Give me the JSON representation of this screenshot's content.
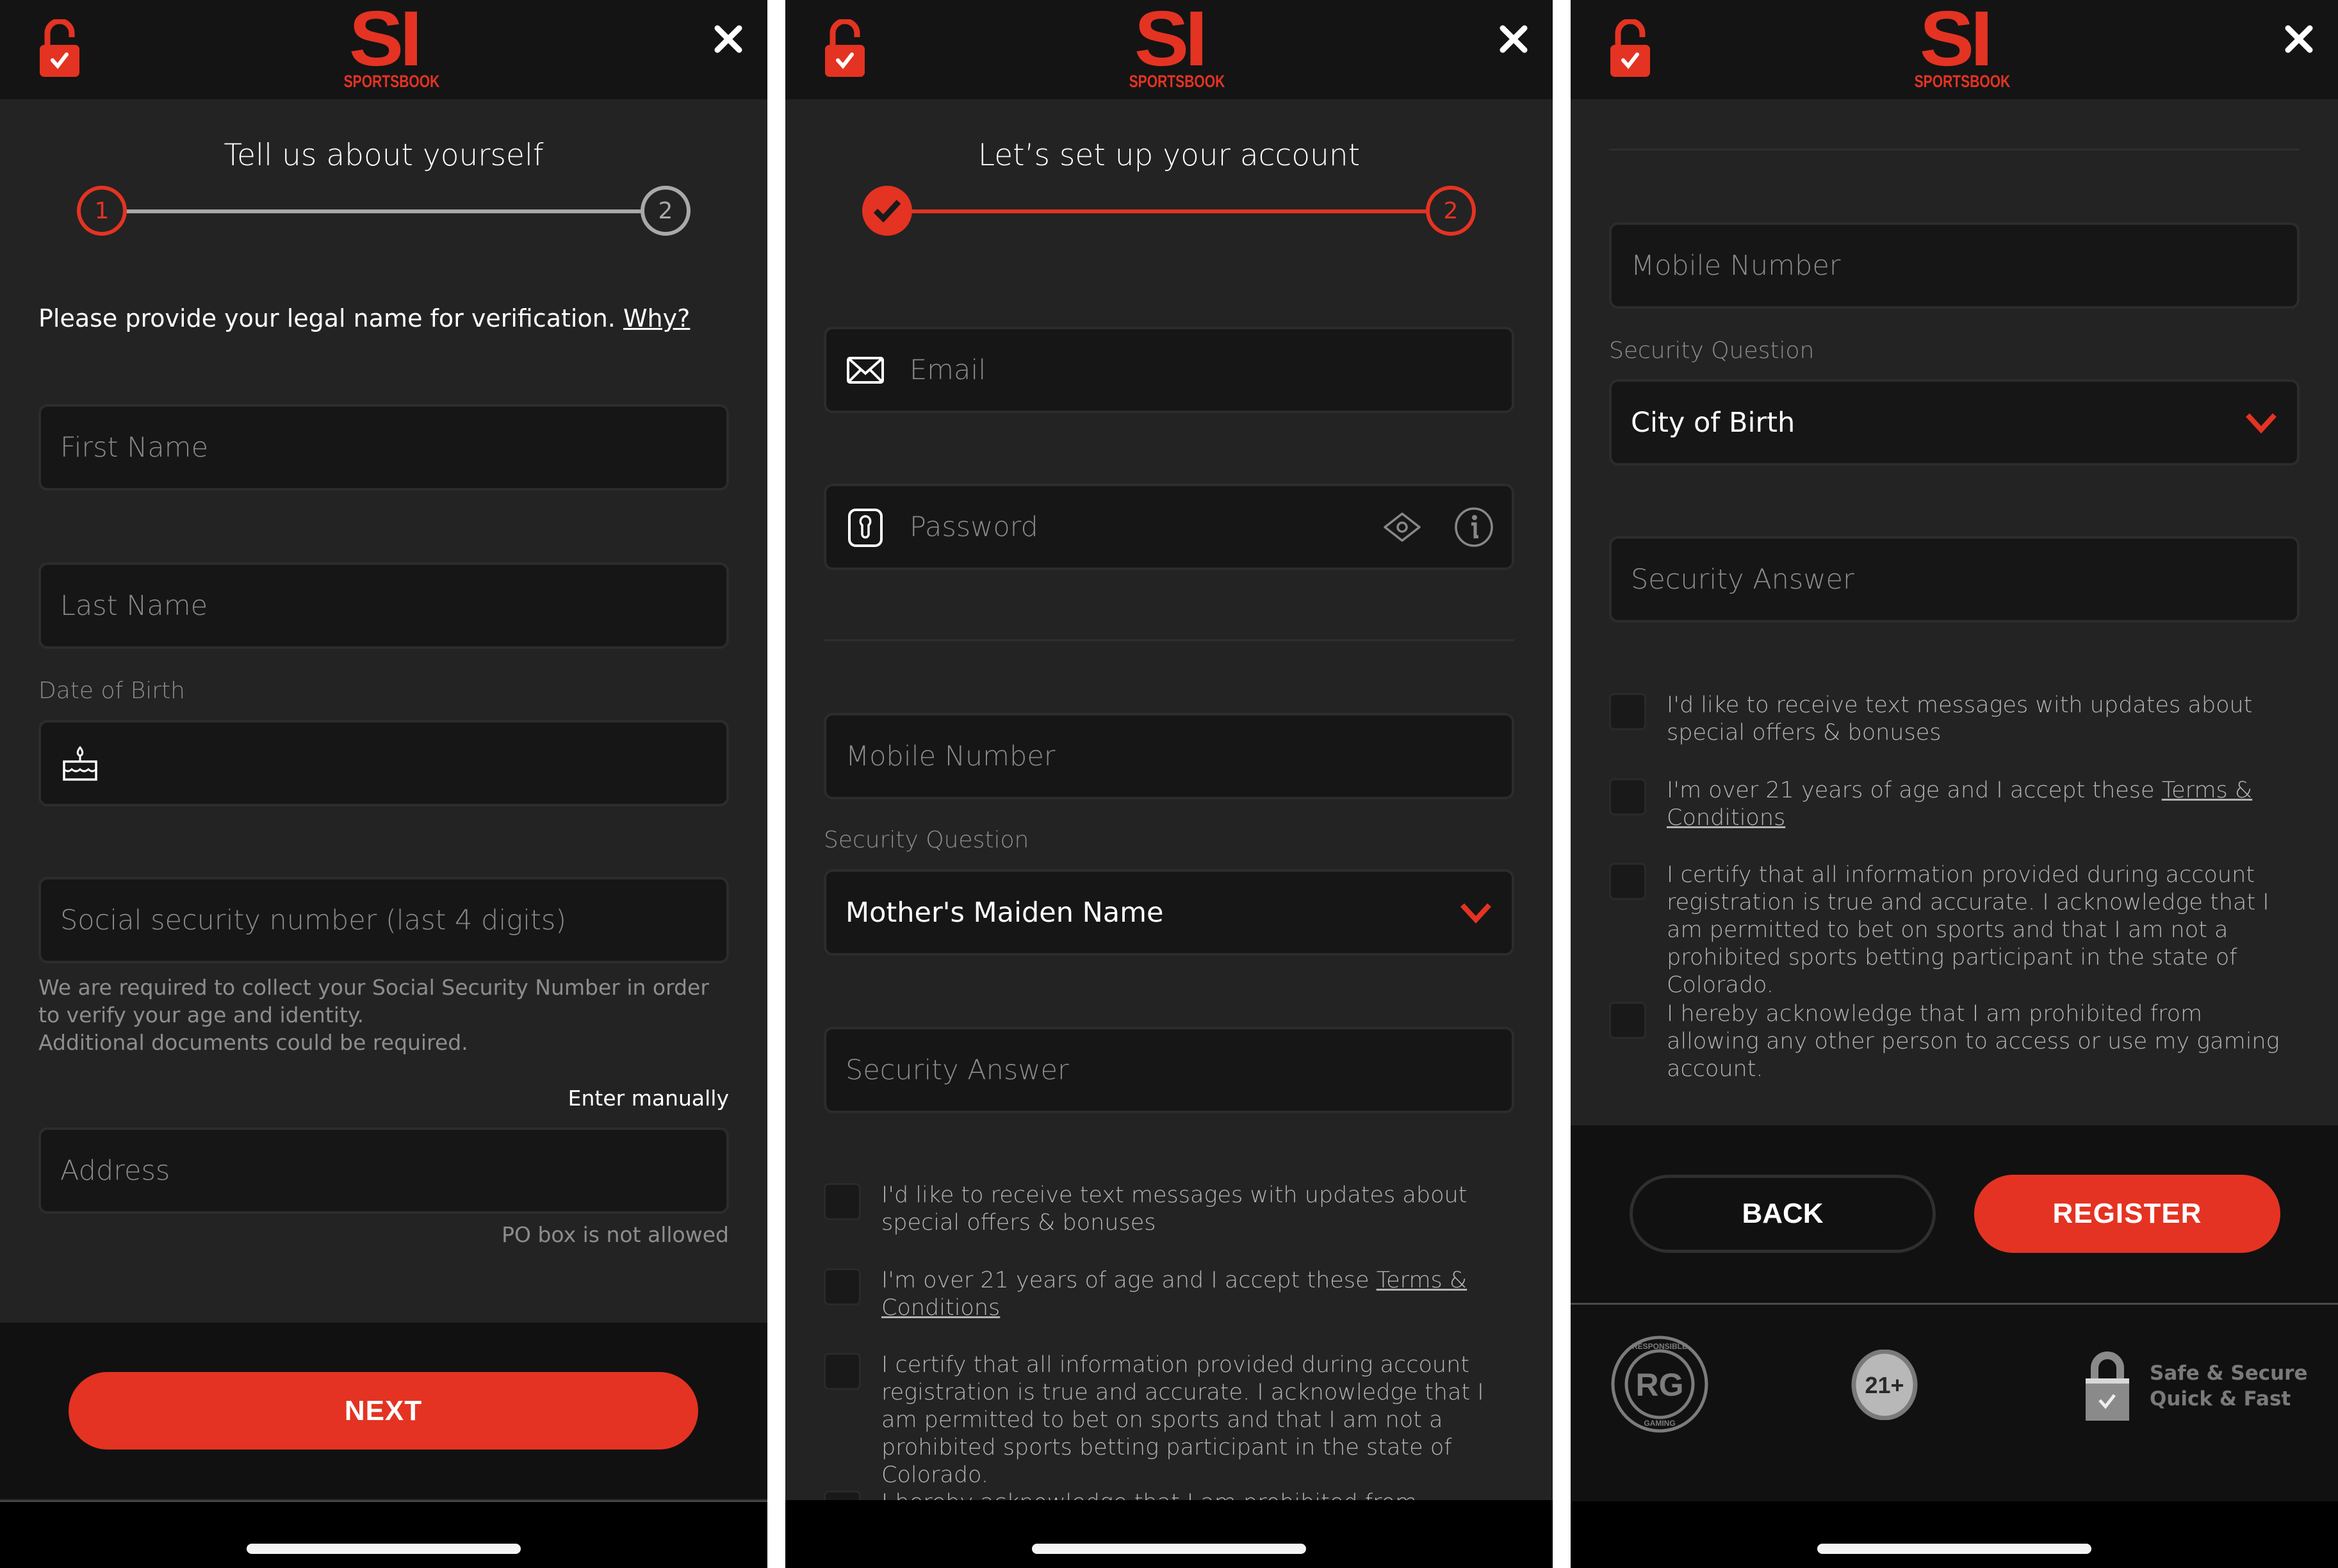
{
  "brand": {
    "logo_main": "SI",
    "logo_sub": "SPORTSBOOK",
    "accent_color": "#e43322"
  },
  "screen1": {
    "title": "Tell us about yourself",
    "stepper": {
      "step1": "1",
      "step2": "2",
      "active_step": 1
    },
    "instruction": "Please provide your legal name for verification.",
    "why_link": "Why?",
    "first_name_placeholder": "First Name",
    "last_name_placeholder": "Last Name",
    "dob_label": "Date of Birth",
    "dob_value": "",
    "ssn_placeholder": "Social security number (last 4 digits)",
    "ssn_helper_line1": "We are required to collect your Social Security Number in order to verify your age and identity.",
    "ssn_helper_line2": "Additional documents could be required.",
    "enter_manually": "Enter manually",
    "address_placeholder": "Address",
    "po_box_note": "PO box is not allowed",
    "next_button": "NEXT"
  },
  "screen2": {
    "title": "Let’s set up your account",
    "stepper": {
      "step1_done": true,
      "step2": "2",
      "active_step": 2
    },
    "email_placeholder": "Email",
    "password_placeholder": "Password",
    "mobile_placeholder": "Mobile Number",
    "security_question_label": "Security Question",
    "security_question_value": "Mother's Maiden Name",
    "security_answer_placeholder": "Security Answer",
    "checkboxes": [
      {
        "text": "I'd like to receive text messages with updates about special offers & bonuses",
        "checked": false
      },
      {
        "text": "I'm over 21 years of age and I accept these ",
        "link": "Terms & Conditions",
        "checked": false
      },
      {
        "text": "I certify that all information provided during account registration is true and accurate. I acknowledge that I am permitted to bet on sports and that I am not a prohibited sports betting participant in the state of Colorado.",
        "checked": false
      },
      {
        "text": "I hereby acknowledge that I am prohibited from allowing any other person to access or use my gaming account.",
        "checked": false
      }
    ]
  },
  "screen3": {
    "mobile_placeholder": "Mobile Number",
    "security_question_label": "Security Question",
    "security_question_value": "City of Birth",
    "security_answer_placeholder": "Security Answer",
    "checkboxes": [
      {
        "text": "I'd like to receive text messages with updates about special offers & bonuses",
        "checked": false
      },
      {
        "text": "I'm over 21 years of age and I accept these ",
        "link": "Terms & Conditions",
        "checked": false
      },
      {
        "text": "I certify that all information provided during account registration is true and accurate. I acknowledge that I am permitted to bet on sports and that I am not a prohibited sports betting participant in the state of Colorado.",
        "checked": false
      },
      {
        "text": "I hereby acknowledge that I am prohibited from allowing any other person to access or use my gaming account.",
        "checked": false
      }
    ],
    "back_button": "BACK",
    "register_button": "REGISTER",
    "badges": {
      "rg_text": "RG",
      "rg_ring_top": "RESPONSIBLE",
      "rg_ring_bottom": "GAMING",
      "age_text": "21+",
      "secure_line1": "Safe & Secure",
      "secure_line2": "Quick & Fast"
    }
  }
}
